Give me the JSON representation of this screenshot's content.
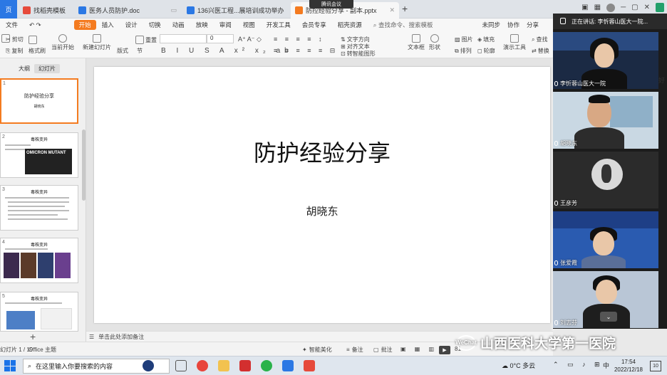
{
  "tabs": {
    "home": "页",
    "items": [
      {
        "label": "找稻壳模板",
        "icon": "wps-docer-icon",
        "color": "#e64a3b"
      },
      {
        "label": "医务人员防护.doc",
        "icon": "word-doc-icon",
        "color": "#2b78e4"
      },
      {
        "label": "136兴医工程...展培训成功举办",
        "icon": "word-doc-icon",
        "color": "#2b78e4"
      },
      {
        "label": "防控经验分享 - 副本.pptx",
        "icon": "ppt-icon",
        "color": "#f47b20"
      }
    ],
    "new_tab": "+",
    "meeting_badge": "腾讯会议"
  },
  "menubar": {
    "file": "文件",
    "items": [
      "开始",
      "插入",
      "设计",
      "切换",
      "动画",
      "放映",
      "审阅",
      "视图",
      "开发工具",
      "会员专享",
      "稻壳资源"
    ],
    "active": "开始",
    "search": "查找命令、搜索模板",
    "right": [
      "未同步",
      "协作",
      "分享"
    ]
  },
  "toolbar": {
    "cut": "剪切",
    "copy": "复制",
    "format_painter": "格式刷",
    "start_from_current": "当前开始",
    "new_slide": "新建幻灯片",
    "layout": "版式",
    "section": "节",
    "reset": "重置",
    "font_size": "0",
    "textbox": "文本框",
    "shape": "形状",
    "arrange": "排列",
    "picture": "图片",
    "fill": "填充",
    "outline": "轮廓",
    "find": "查找",
    "replace": "替换",
    "presentation_tool": "演示工具",
    "text_direction": "文字方向",
    "align_text": "对齐文本",
    "smartart": "转智能图形"
  },
  "left_panel": {
    "tab_outline": "大纲",
    "tab_slides": "幻灯片",
    "thumbnails": [
      {
        "num": "1",
        "title": "防护经验分享",
        "subtitle": "胡晓东",
        "selected": true
      },
      {
        "num": "2",
        "title": "毒株变异",
        "subtitle": "OMICRON MUTANT"
      },
      {
        "num": "3",
        "title": "毒株变异"
      },
      {
        "num": "4",
        "title": "毒株变异"
      },
      {
        "num": "5",
        "title": "毒株变异"
      }
    ],
    "add_slide": "+"
  },
  "slide": {
    "title": "防护经验分享",
    "subtitle": "胡晓东"
  },
  "notes": {
    "placeholder": "单击此处添加备注"
  },
  "statusbar": {
    "page": "幻灯片 1 / 19",
    "theme": "Office 主题",
    "smart_beautify": "智能美化",
    "notes": "备注",
    "comments": "批注",
    "zoom": "81"
  },
  "video_panel": {
    "speaking": "正在讲话: 李忻蓉山医大一院...",
    "participants": [
      {
        "name": "李忻蓉山医大一院",
        "bg": "#1b2a44"
      },
      {
        "name": "胡晓东",
        "bg": "#9fb9cf"
      },
      {
        "name": "王彦芳",
        "bg": "#2b2b2b"
      },
      {
        "name": "张爱霞",
        "bg": "#2a5bb0"
      },
      {
        "name": "刘志芬",
        "bg": "#b9c6d6"
      }
    ]
  },
  "watermark": {
    "text": "山西医科大学第一医院",
    "logo": "WeChat"
  },
  "taskbar": {
    "search_placeholder": "在这里输入你要搜索的内容",
    "weather": "0°C 多云",
    "time": "17:54",
    "date": "2022/12/18",
    "notifications": "10",
    "ime": "中"
  },
  "right_cut_text": "好"
}
